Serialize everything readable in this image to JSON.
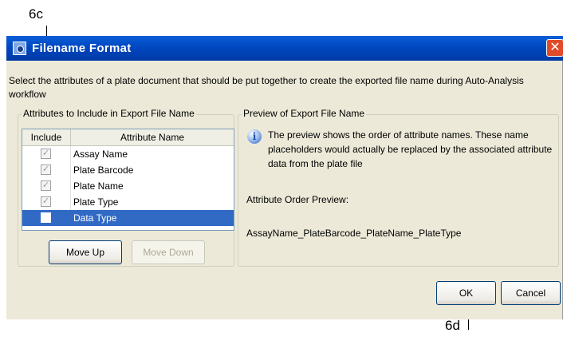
{
  "callouts": {
    "top_left": "6c",
    "bottom": "6d"
  },
  "window": {
    "title": "Filename Format",
    "description": "Select the attributes of a plate document that should be put together to create the exported file name during Auto-Analysis workflow",
    "close_glyph": "✕"
  },
  "attributes_group": {
    "legend": "Attributes to Include in Export File Name",
    "headers": {
      "include": "Include",
      "attribute_name": "Attribute Name"
    },
    "rows": [
      {
        "name": "Assay Name",
        "checked": true
      },
      {
        "name": "Plate Barcode",
        "checked": true
      },
      {
        "name": "Plate Name",
        "checked": true
      },
      {
        "name": "Plate Type",
        "checked": true
      },
      {
        "name": "Data Type",
        "checked": false,
        "selected": true
      }
    ],
    "move_up": "Move Up",
    "move_down": "Move Down"
  },
  "preview_group": {
    "legend": "Preview of Export File Name",
    "info_icon": "info-icon",
    "info_text": "The preview shows the order of attribute names. These name placeholders would actually be replaced by the associated attribute data from the plate file",
    "order_label": "Attribute Order Preview:",
    "order_value": "AssayName_PlateBarcode_PlateName_PlateType"
  },
  "footer": {
    "ok": "OK",
    "cancel": "Cancel"
  },
  "colors": {
    "title_bar": "#0047c0",
    "selection": "#316ac5",
    "dialog_bg": "#ece9d8"
  }
}
